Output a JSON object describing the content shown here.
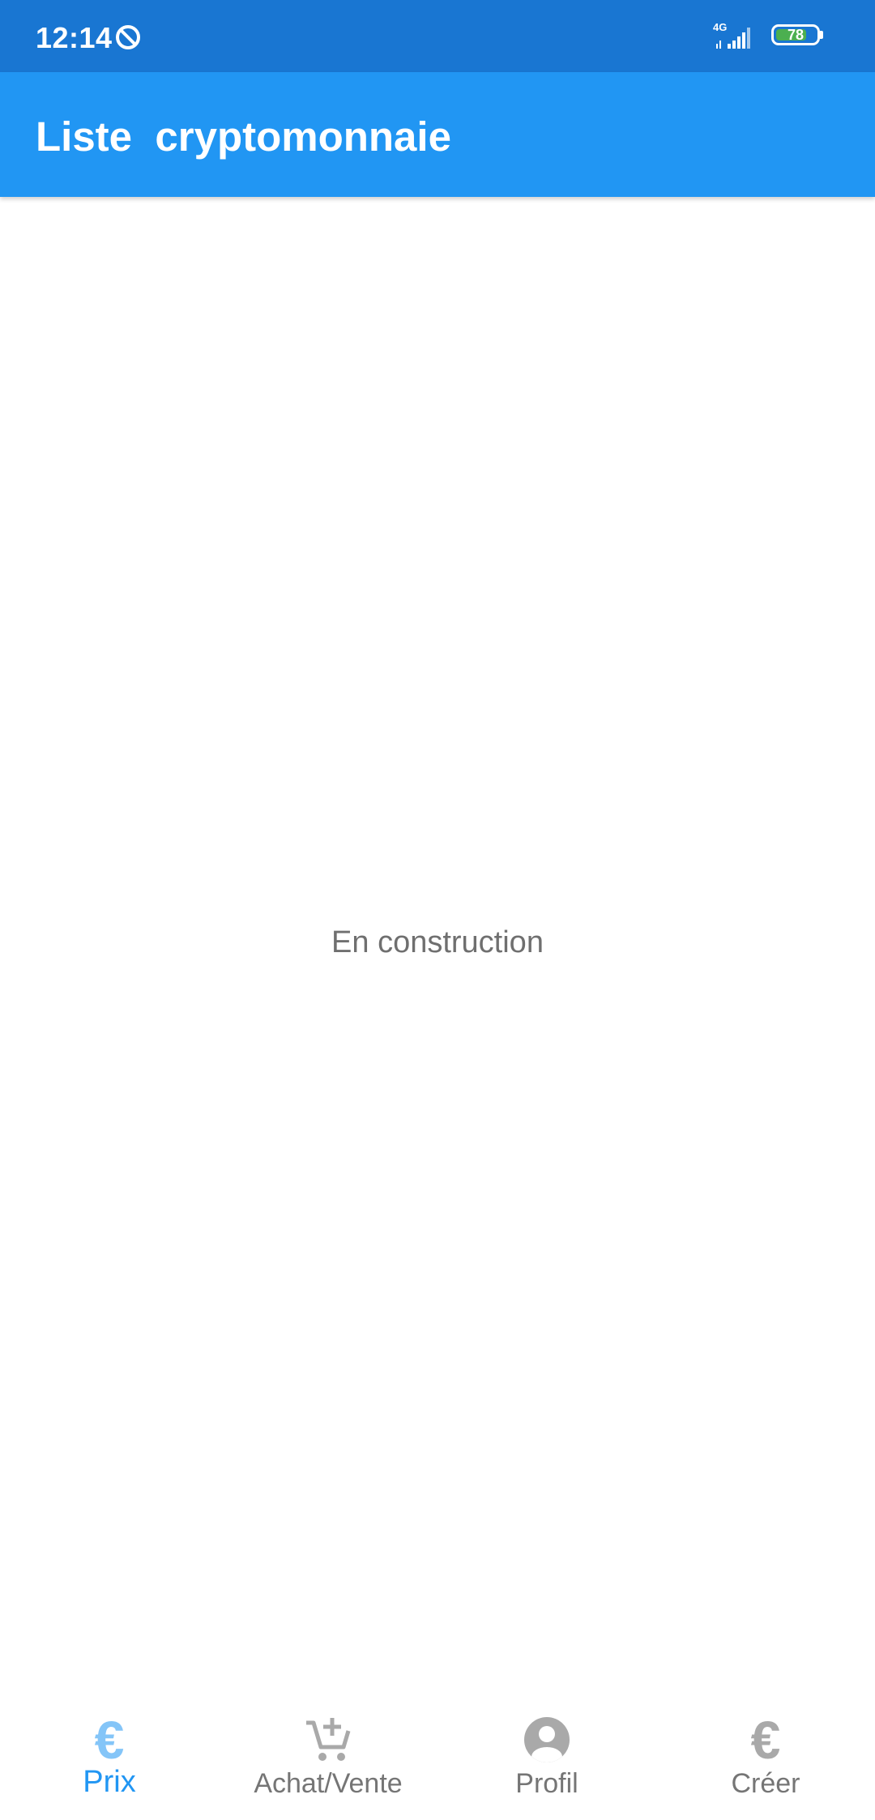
{
  "status_bar": {
    "time": "12:14",
    "network": "4G",
    "battery_level": "78",
    "battery_fraction": 0.78,
    "icons": [
      "do-not-disturb-icon",
      "signal-icon",
      "battery-icon"
    ]
  },
  "app_bar": {
    "title": "Liste  cryptomonnaie"
  },
  "content": {
    "message": "En construction"
  },
  "bottom_nav": {
    "items": [
      {
        "label": "Prix",
        "icon": "euro-icon",
        "active": true
      },
      {
        "label": "Achat/Vente",
        "icon": "add-cart-icon",
        "active": false
      },
      {
        "label": "Profil",
        "icon": "account-circle-icon",
        "active": false
      },
      {
        "label": "Créer",
        "icon": "euro-icon",
        "active": false
      }
    ]
  },
  "colors": {
    "status_bar": "#1976d2",
    "app_bar": "#2196f3",
    "active_tab": "#2196f3",
    "inactive_tab": "#757575",
    "inactive_icon": "#a9a9a9",
    "battery_fill": "#4caf50"
  }
}
